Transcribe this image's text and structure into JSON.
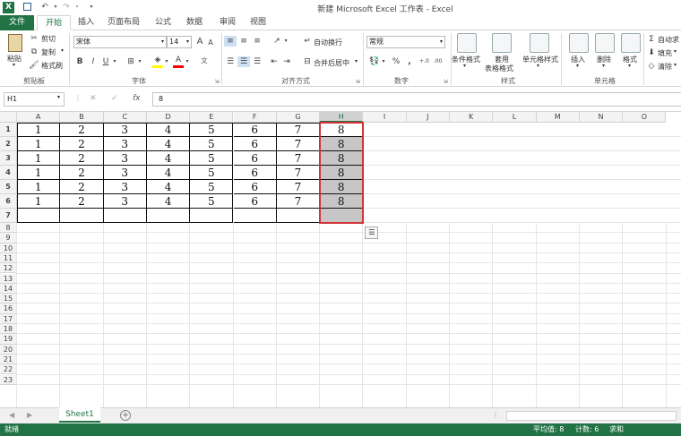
{
  "window": {
    "title": "新建 Microsoft Excel 工作表 - Excel"
  },
  "tabs": [
    "文件",
    "开始",
    "插入",
    "页面布局",
    "公式",
    "数据",
    "审阅",
    "视图"
  ],
  "ribbon": {
    "clipboard": {
      "paste": "粘贴",
      "cut": "剪切",
      "copy": "复制",
      "format_painter": "格式刷",
      "group_label": "剪贴板"
    },
    "font": {
      "name": "宋体",
      "size": "14",
      "bold": "B",
      "italic": "I",
      "underline": "U",
      "grow": "A",
      "shrink": "A",
      "font_color": "A",
      "group_label": "字体"
    },
    "alignment": {
      "wrap_text": "自动换行",
      "merge_center": "合并后居中",
      "group_label": "对齐方式"
    },
    "number": {
      "format": "常规",
      "percent": "%",
      "comma": ",",
      "group_label": "数字"
    },
    "styles": {
      "conditional": "条件格式",
      "table_line1": "套用",
      "table_line2": "表格格式",
      "cell_styles": "单元格样式",
      "group_label": "样式"
    },
    "cells": {
      "insert": "插入",
      "delete": "删除",
      "format": "格式",
      "group_label": "单元格"
    },
    "editing": {
      "autosum": "自动求",
      "fill": "填充",
      "clear": "清除"
    }
  },
  "formula_bar": {
    "name_box": "H1",
    "cancel": "✕",
    "enter": "✓",
    "fx": "fx",
    "content": "8"
  },
  "grid": {
    "columns": [
      "A",
      "B",
      "C",
      "D",
      "E",
      "F",
      "G",
      "H",
      "I",
      "J",
      "K",
      "L",
      "M",
      "N",
      "O"
    ],
    "rows": [
      "1",
      "2",
      "3",
      "4",
      "5",
      "6",
      "7",
      "8",
      "9",
      "10",
      "11",
      "12",
      "13",
      "14",
      "15",
      "16",
      "17",
      "18",
      "19",
      "20",
      "21",
      "22",
      "23"
    ],
    "data": [
      [
        "1",
        "2",
        "3",
        "4",
        "5",
        "6",
        "7",
        "8"
      ],
      [
        "1",
        "2",
        "3",
        "4",
        "5",
        "6",
        "7",
        "8"
      ],
      [
        "1",
        "2",
        "3",
        "4",
        "5",
        "6",
        "7",
        "8"
      ],
      [
        "1",
        "2",
        "3",
        "4",
        "5",
        "6",
        "7",
        "8"
      ],
      [
        "1",
        "2",
        "3",
        "4",
        "5",
        "6",
        "7",
        "8"
      ],
      [
        "1",
        "2",
        "3",
        "4",
        "5",
        "6",
        "7",
        "8"
      ],
      [
        "",
        "",
        "",
        "",
        "",
        "",
        "",
        ""
      ]
    ]
  },
  "sheets": {
    "active": "Sheet1",
    "add": "+"
  },
  "status": {
    "ready": "就绪",
    "average": "平均值: 8",
    "count": "计数: 6",
    "sum": "求和"
  },
  "colors": {
    "excel_green": "#217346",
    "selection_border": "#d13438",
    "selection_fill": "#c6c6c6"
  }
}
